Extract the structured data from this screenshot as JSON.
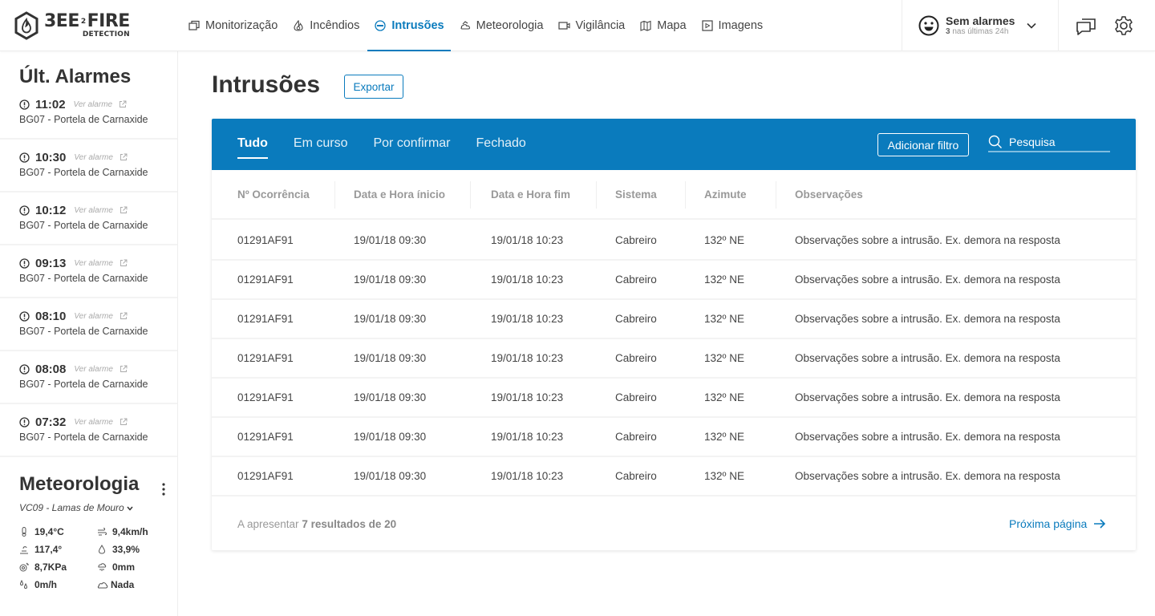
{
  "brand": {
    "name_main": "3EE",
    "name_mid": "2",
    "name_end": "FIRE",
    "tagline": "DETECTION"
  },
  "nav": {
    "items": [
      {
        "label": "Monitorização",
        "icon": "windows-icon",
        "active": false
      },
      {
        "label": "Incêndios",
        "icon": "flame-icon",
        "active": false
      },
      {
        "label": "Intrusões",
        "icon": "intrusion-icon",
        "active": true
      },
      {
        "label": "Meteorologia",
        "icon": "weather-icon",
        "active": false
      },
      {
        "label": "Vigilância",
        "icon": "camera-icon",
        "active": false
      },
      {
        "label": "Mapa",
        "icon": "map-icon",
        "active": false
      },
      {
        "label": "Imagens",
        "icon": "images-icon",
        "active": false
      }
    ]
  },
  "alarm_status": {
    "title": "Sem alarmes",
    "count": "3",
    "sub": "nas últimas 24h"
  },
  "sidebar": {
    "title": "Últ. Alarmes",
    "link_label": "Ver alarme",
    "alarms": [
      {
        "time": "11:02",
        "location": "BG07 - Portela de Carnaxide"
      },
      {
        "time": "10:30",
        "location": "BG07 - Portela de Carnaxide"
      },
      {
        "time": "10:12",
        "location": "BG07 - Portela de Carnaxide"
      },
      {
        "time": "09:13",
        "location": "BG07 - Portela de Carnaxide"
      },
      {
        "time": "08:10",
        "location": "BG07 - Portela de Carnaxide"
      },
      {
        "time": "08:08",
        "location": "BG07 - Portela de Carnaxide"
      },
      {
        "time": "07:32",
        "location": "BG07 - Portela de Carnaxide"
      }
    ]
  },
  "meteo": {
    "title": "Meteorologia",
    "station": "VC09 - Lamas de Mouro",
    "values": {
      "temperature": "19,4°C",
      "wind_speed": "9,4km/h",
      "wind_direction": "117,4°",
      "humidity": "33,9%",
      "pressure": "8,7KPa",
      "precipitation": "0mm",
      "rain_rate": "0m/h",
      "sky": "Nada"
    }
  },
  "page": {
    "title": "Intrusões",
    "export_label": "Exportar"
  },
  "table_card": {
    "tabs": [
      {
        "label": "Tudo",
        "active": true
      },
      {
        "label": "Em curso",
        "active": false
      },
      {
        "label": "Por confirmar",
        "active": false
      },
      {
        "label": "Fechado",
        "active": false
      }
    ],
    "filter_label": "Adicionar filtro",
    "search_placeholder": "Pesquisa",
    "columns": [
      "Nº Ocorrência",
      "Data e Hora ínicio",
      "Data e Hora fim",
      "Sistema",
      "Azimute",
      "Observações"
    ],
    "rows": [
      [
        "01291AF91",
        "19/01/18 09:30",
        "19/01/18 10:23",
        "Cabreiro",
        "132º NE",
        "Observações sobre a intrusão. Ex. demora na resposta"
      ],
      [
        "01291AF91",
        "19/01/18 09:30",
        "19/01/18 10:23",
        "Cabreiro",
        "132º NE",
        "Observações sobre a intrusão. Ex. demora na resposta"
      ],
      [
        "01291AF91",
        "19/01/18 09:30",
        "19/01/18 10:23",
        "Cabreiro",
        "132º NE",
        "Observações sobre a intrusão. Ex. demora na resposta"
      ],
      [
        "01291AF91",
        "19/01/18 09:30",
        "19/01/18 10:23",
        "Cabreiro",
        "132º NE",
        "Observações sobre a intrusão. Ex. demora na resposta"
      ],
      [
        "01291AF91",
        "19/01/18 09:30",
        "19/01/18 10:23",
        "Cabreiro",
        "132º NE",
        "Observações sobre a intrusão. Ex. demora na resposta"
      ],
      [
        "01291AF91",
        "19/01/18 09:30",
        "19/01/18 10:23",
        "Cabreiro",
        "132º NE",
        "Observações sobre a intrusão. Ex. demora na resposta"
      ],
      [
        "01291AF91",
        "19/01/18 09:30",
        "19/01/18 10:23",
        "Cabreiro",
        "132º NE",
        "Observações sobre a intrusão. Ex. demora na resposta"
      ]
    ],
    "footer_prefix": "A apresentar",
    "footer_count": "7 resultados de 20",
    "next_label": "Próxima página"
  },
  "colors": {
    "accent": "#0a7bbd",
    "text": "#333333",
    "muted": "#999999"
  }
}
